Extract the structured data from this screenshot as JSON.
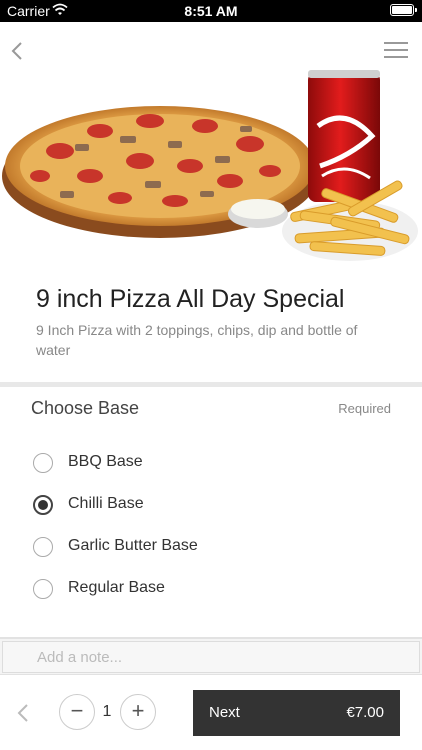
{
  "status_bar": {
    "carrier": "Carrier",
    "time": "8:51 AM"
  },
  "product": {
    "title": "9 inch Pizza All Day Special",
    "description": "9 Inch Pizza with 2 toppings, chips, dip and bottle of water"
  },
  "base_section": {
    "title": "Choose Base",
    "required_label": "Required",
    "options": [
      {
        "label": "BBQ Base",
        "selected": false
      },
      {
        "label": "Chilli Base",
        "selected": true
      },
      {
        "label": "Garlic Butter Base",
        "selected": false
      },
      {
        "label": "Regular Base",
        "selected": false
      }
    ]
  },
  "note": {
    "placeholder": "Add a note..."
  },
  "footer": {
    "quantity": "1",
    "minus": "−",
    "plus": "+",
    "next_label": "Next",
    "price": "€7.00"
  },
  "colors": {
    "accent_button": "#333333",
    "divider": "#e8e8e8"
  }
}
